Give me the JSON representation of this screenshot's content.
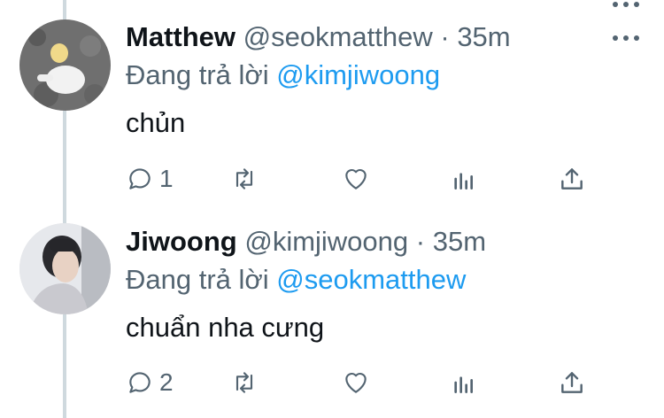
{
  "tweets": [
    {
      "name": "Matthew",
      "handle": "@seokmatthew",
      "separator": "·",
      "time": "35m",
      "reply_label": "Đang trả lời",
      "reply_to": "@kimjiwoong",
      "text": "chủn",
      "reply_count": "1"
    },
    {
      "name": "Jiwoong",
      "handle": "@kimjiwoong",
      "separator": "·",
      "time": "35m",
      "reply_label": "Đang trả lời",
      "reply_to": "@seokmatthew",
      "text": "chuẩn nha cưng",
      "reply_count": "2"
    }
  ],
  "icons": [
    "comment-icon",
    "retweet-icon",
    "heart-icon",
    "analytics-icon",
    "share-icon",
    "more-icon"
  ],
  "colors": {
    "link": "#1d9bf0",
    "secondary_text": "#536471",
    "thread_line": "#cfd9de"
  }
}
